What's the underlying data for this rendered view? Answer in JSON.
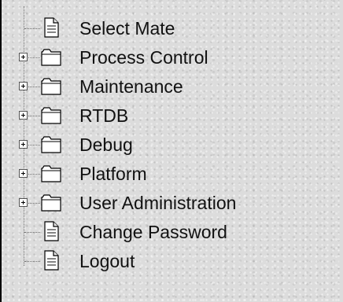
{
  "tree": {
    "items": [
      {
        "label": "Select Mate",
        "type": "page",
        "expandable": false
      },
      {
        "label": "Process Control",
        "type": "folder",
        "expandable": true
      },
      {
        "label": "Maintenance",
        "type": "folder",
        "expandable": true
      },
      {
        "label": "RTDB",
        "type": "folder",
        "expandable": true
      },
      {
        "label": "Debug",
        "type": "folder",
        "expandable": true
      },
      {
        "label": "Platform",
        "type": "folder",
        "expandable": true
      },
      {
        "label": "User Administration",
        "type": "folder",
        "expandable": true
      },
      {
        "label": "Change Password",
        "type": "page",
        "expandable": false
      },
      {
        "label": "Logout",
        "type": "page",
        "expandable": false
      }
    ]
  },
  "colors": {
    "background": "#dcdcdc",
    "text": "#111111",
    "border": "#000000"
  },
  "icons": {
    "page": "page-icon",
    "folder": "folder-icon",
    "expander": "plus-expander-icon"
  }
}
